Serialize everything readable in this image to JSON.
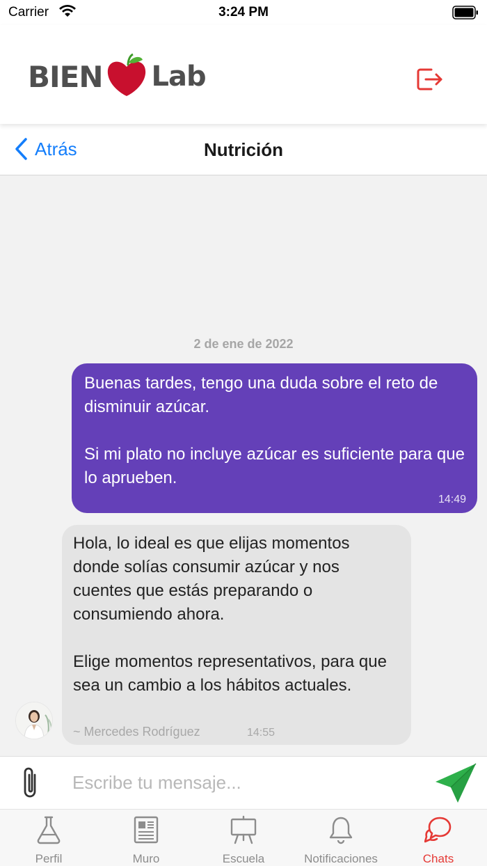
{
  "status_bar": {
    "carrier": "Carrier",
    "time": "3:24 PM"
  },
  "header": {
    "logo_left": "BIEN",
    "logo_right": "Lab",
    "logout_icon": "logout-icon",
    "brand_color": "#e53935"
  },
  "nav": {
    "back_label": "Atrás",
    "title": "Nutrición",
    "accent": "#147efb"
  },
  "chat": {
    "date": "2 de ene de 2022",
    "messages": [
      {
        "direction": "outgoing",
        "text": "Buenas tardes, tengo una duda sobre el reto de disminuir azúcar.\n\nSi mi plato no incluye azúcar es suficiente para que lo aprueben.",
        "time": "14:49",
        "color": "#6440b8"
      },
      {
        "direction": "incoming",
        "text": "Hola, lo ideal es que elijas momentos donde solías consumir azúcar y nos cuentes que estás preparando o consumiendo ahora.\n\nElige momentos representativos, para que sea un cambio a los hábitos actuales.",
        "sender": "~ Mercedes Rodríguez",
        "time": "14:55",
        "color": "#e4e4e4"
      }
    ]
  },
  "composer": {
    "placeholder": "Escribe tu mensaje...",
    "value": "",
    "send_color": "#2eb04b"
  },
  "tabs": [
    {
      "label": "Perfil",
      "icon": "flask-icon",
      "active": false
    },
    {
      "label": "Muro",
      "icon": "newspaper-icon",
      "active": false
    },
    {
      "label": "Escuela",
      "icon": "easel-icon",
      "active": false
    },
    {
      "label": "Notificaciones",
      "icon": "bell-icon",
      "active": false
    },
    {
      "label": "Chats",
      "icon": "chat-bubbles-icon",
      "active": true
    }
  ]
}
